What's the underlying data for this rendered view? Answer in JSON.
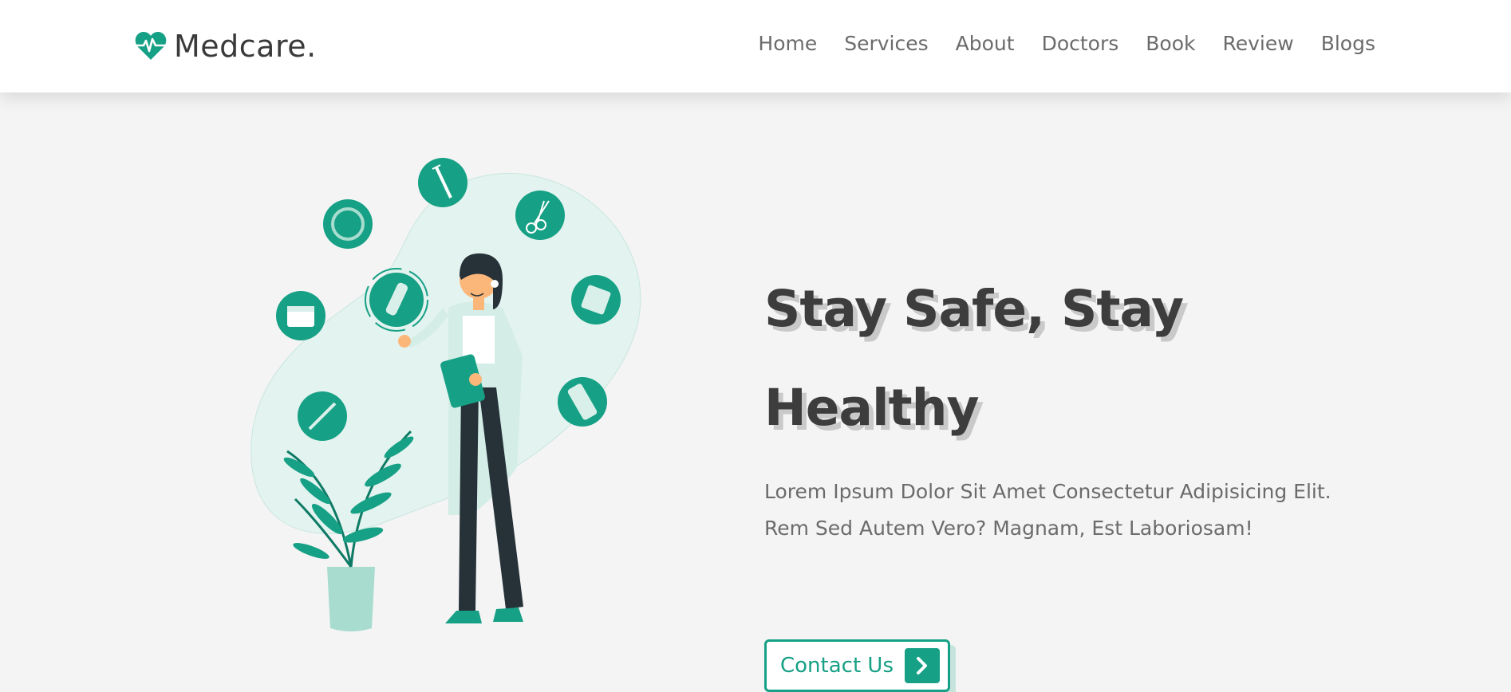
{
  "brand": {
    "name": "Medcare.",
    "color": "#16a085",
    "icon": "heart-pulse-icon"
  },
  "nav": {
    "items": [
      "Home",
      "Services",
      "About",
      "Doctors",
      "Book",
      "Review",
      "Blogs"
    ]
  },
  "hero": {
    "title_line1": "Stay Safe, Stay",
    "title_line2": "Healthy",
    "description_line1": "Lorem Ipsum Dolor Sit Amet Consectetur Adipisicing Elit.",
    "description_line2": "Rem Sed Autem Vero? Magnam, Est Laboriosam!",
    "cta_label": "Contact Us",
    "cta_icon": "chevron-right-icon"
  }
}
